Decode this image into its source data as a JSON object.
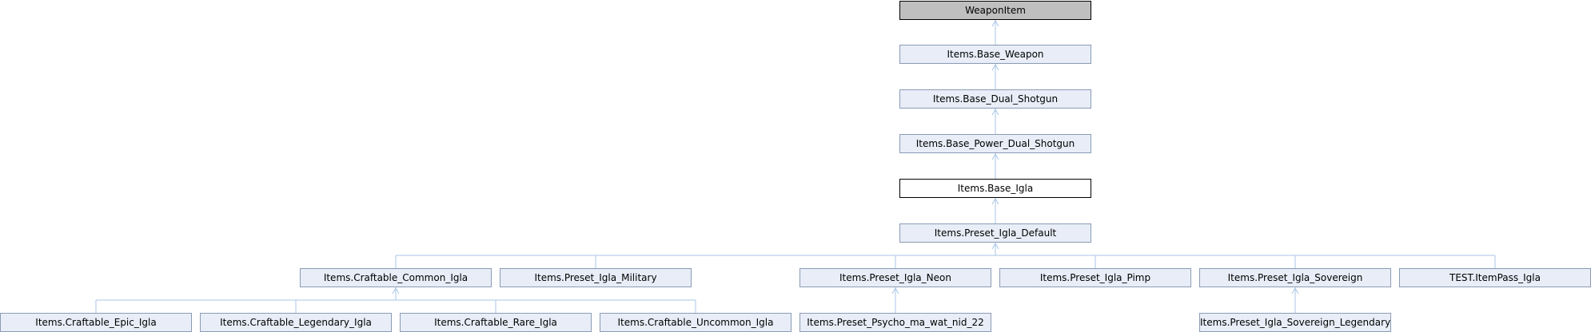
{
  "colors": {
    "edge": "#a9c6e6",
    "node_fill": "#e8edf7",
    "node_border": "#8a9bb5",
    "external_fill": "#bfbfbf",
    "current_fill": "#ffffff"
  },
  "nodes": {
    "weapon_item": "WeaponItem",
    "base_weapon": "Items.Base_Weapon",
    "base_dual_shotgun": "Items.Base_Dual_Shotgun",
    "base_power_dual_shotgun": "Items.Base_Power_Dual_Shotgun",
    "base_igla": "Items.Base_Igla",
    "preset_igla_default": "Items.Preset_Igla_Default",
    "craftable_common_igla": "Items.Craftable_Common_Igla",
    "preset_igla_military": "Items.Preset_Igla_Military",
    "preset_igla_neon": "Items.Preset_Igla_Neon",
    "preset_igla_pimp": "Items.Preset_Igla_Pimp",
    "preset_igla_sovereign": "Items.Preset_Igla_Sovereign",
    "test_itempass_igla": "TEST.ItemPass_Igla",
    "craftable_epic_igla": "Items.Craftable_Epic_Igla",
    "craftable_legendary_igla": "Items.Craftable_Legendary_Igla",
    "craftable_rare_igla": "Items.Craftable_Rare_Igla",
    "craftable_uncommon_igla": "Items.Craftable_Uncommon_Igla",
    "preset_psycho": "Items.Preset_Psycho_ma_wat_nid_22",
    "preset_igla_sovereign_legendary": "Items.Preset_Igla_Sovereign_Legendary"
  }
}
